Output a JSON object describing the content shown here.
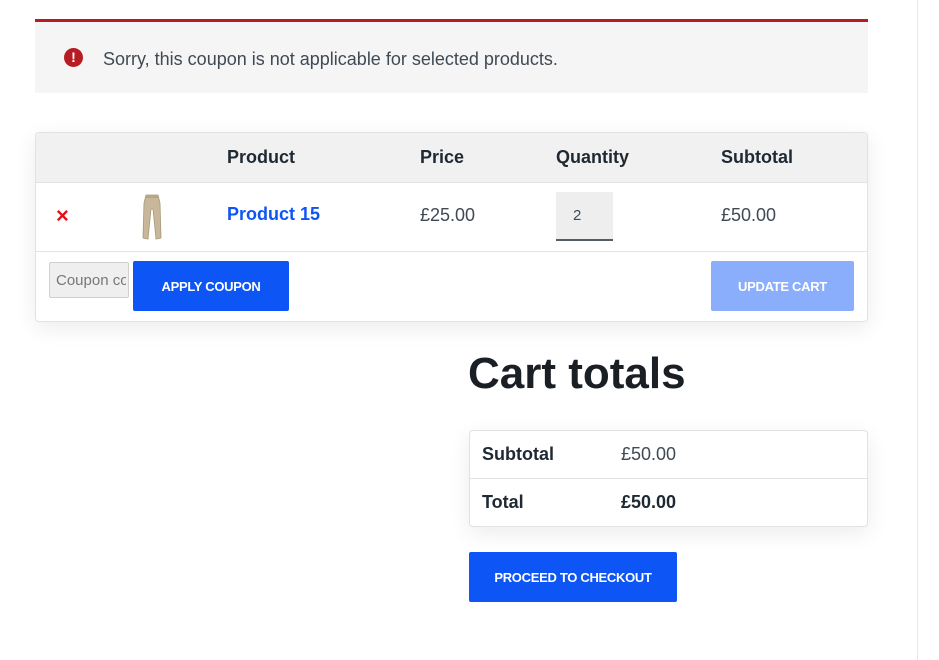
{
  "notice": {
    "icon": "exclamation-circle-icon",
    "message": "Sorry, this coupon is not applicable for selected products.",
    "accent_color": "#b81c23"
  },
  "cart_table": {
    "headers": [
      "Product",
      "Price",
      "Quantity",
      "Subtotal"
    ],
    "rows": [
      {
        "remove_icon": "×",
        "thumbnail": "trousers-thumbnail",
        "product": "Product 15",
        "price": "£25.00",
        "quantity": "2",
        "subtotal": "£50.00"
      }
    ],
    "coupon_placeholder": "Coupon code",
    "apply_coupon_label": "APPLY COUPON",
    "update_cart_label": "UPDATE CART"
  },
  "cart_totals": {
    "title": "Cart totals",
    "subtotal_label": "Subtotal",
    "subtotal_value": "£50.00",
    "total_label": "Total",
    "total_value": "£50.00",
    "checkout_label": "PROCEED TO CHECKOUT"
  },
  "colors": {
    "primary": "#0d55f5",
    "primary_disabled": "#8aaefb",
    "remove": "#e0131a"
  }
}
